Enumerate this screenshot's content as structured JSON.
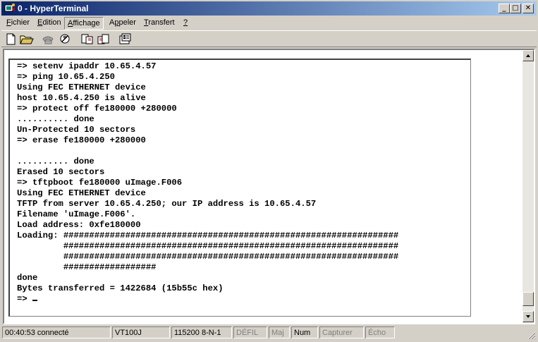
{
  "window": {
    "title": "0 - HyperTerminal",
    "controls": {
      "minimize": "_",
      "maximize": "□",
      "close": "✕"
    }
  },
  "menu": [
    {
      "label": "Fichier",
      "accel": "F",
      "rest": "ichier"
    },
    {
      "label": "Edition",
      "accel": "E",
      "rest": "dition"
    },
    {
      "label": "Affichage",
      "accel": "A",
      "rest": "ffichage"
    },
    {
      "label": "Appeler",
      "pre": "A",
      "accel": "p",
      "rest": "peler"
    },
    {
      "label": "Transfert",
      "accel": "T",
      "rest": "ransfert"
    },
    {
      "label": "?",
      "accel": "?",
      "rest": ""
    }
  ],
  "toolbar": [
    {
      "icon": "new-document-icon"
    },
    {
      "icon": "open-folder-icon"
    },
    {
      "icon": "call-icon"
    },
    {
      "icon": "disconnect-icon"
    },
    {
      "icon": "send-icon"
    },
    {
      "icon": "receive-icon"
    },
    {
      "icon": "properties-icon"
    }
  ],
  "terminal": {
    "lines": [
      "=> setenv ipaddr 10.65.4.57",
      "=> ping 10.65.4.250",
      "Using FEC ETHERNET device",
      "host 10.65.4.250 is alive",
      "=> protect off fe180000 +280000",
      ".......... done",
      "Un-Protected 10 sectors",
      "=> erase fe180000 +280000",
      "",
      ".......... done",
      "Erased 10 sectors",
      "=> tftpboot fe180000 uImage.F006",
      "Using FEC ETHERNET device",
      "TFTP from server 10.65.4.250; our IP address is 10.65.4.57",
      "Filename 'uImage.F006'.",
      "Load address: 0xfe180000",
      "Loading: #################################################################",
      "         #################################################################",
      "         #################################################################",
      "         ##################",
      "done",
      "Bytes transferred = 1422684 (15b55c hex)"
    ],
    "prompt": "=> "
  },
  "status": {
    "connected": "00:40:53 connecté",
    "emulation": "VT100J",
    "settings": "115200 8-N-1",
    "scroll": "DÉFIL",
    "caps": "Maj",
    "num": "Num",
    "capture": "Capturer",
    "echo": "Écho"
  },
  "colors": {
    "titlebar_start": "#0a246a",
    "titlebar_end": "#a6caf0",
    "face": "#d4d0c8"
  }
}
